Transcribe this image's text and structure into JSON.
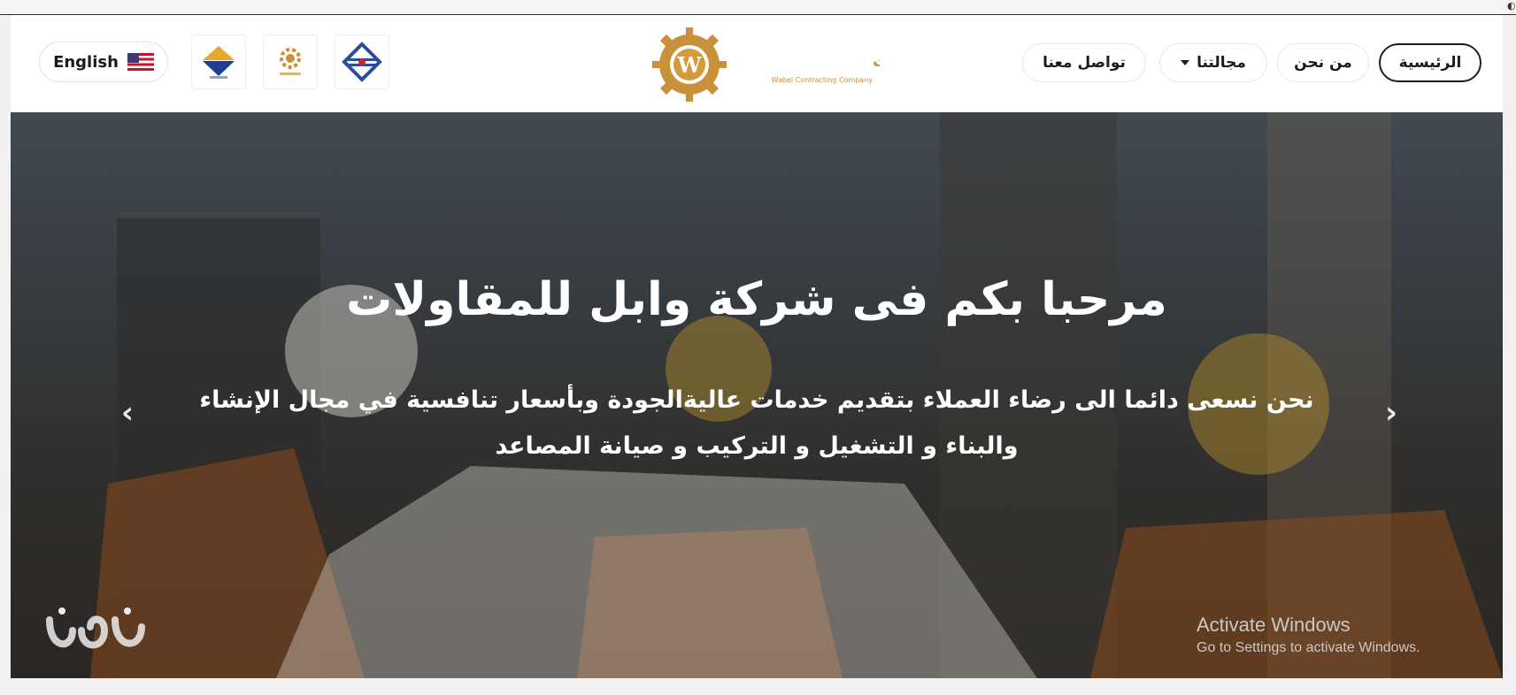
{
  "header": {
    "language_label": "English",
    "flag_icon": "us-flag-icon",
    "logo": {
      "arabic_name": "شركة وابل للمقاولات",
      "english_name": "Wabel Contracting Company",
      "letter": "W"
    },
    "nav": {
      "home": "الرئيسية",
      "about": "من نحن",
      "fields": "مجالتنا",
      "contact": "تواصل معنا"
    }
  },
  "hero": {
    "title": "مرحبا بكم فى شركة وابل للمقاولات",
    "subtitle_line1": "نحن نسعى دائما الى رضاء العملاء بتقديم خدمات عاليةالجودة وبأسعار تنافسية في مجال الإنشاء",
    "subtitle_line2": "والبناء و التشغيل و التركيب و صيانة المصاعد",
    "prev_arrow": "‹",
    "next_arrow": "›"
  },
  "overlay": {
    "activate_title": "Activate Windows",
    "activate_sub": "Go to Settings to activate Windows."
  },
  "colors": {
    "logo_gold": "#c9913a",
    "nav_text": "#1b1b1b",
    "hero_text": "#ffffff"
  }
}
